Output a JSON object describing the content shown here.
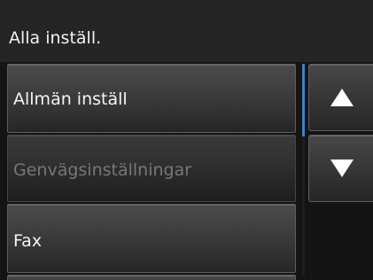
{
  "header": {
    "title": "Alla inställ."
  },
  "menu": {
    "items": [
      {
        "label": "Allmän inställ",
        "enabled": true
      },
      {
        "label": "Genvägsinställningar",
        "enabled": false
      },
      {
        "label": "Fax",
        "enabled": true
      }
    ]
  },
  "scroll": {
    "up_icon": "triangle-up-icon",
    "down_icon": "triangle-down-icon"
  },
  "colors": {
    "text": "#f4f4f4",
    "disabled_text": "#777777",
    "scroll_thumb": "#3d82c4"
  }
}
